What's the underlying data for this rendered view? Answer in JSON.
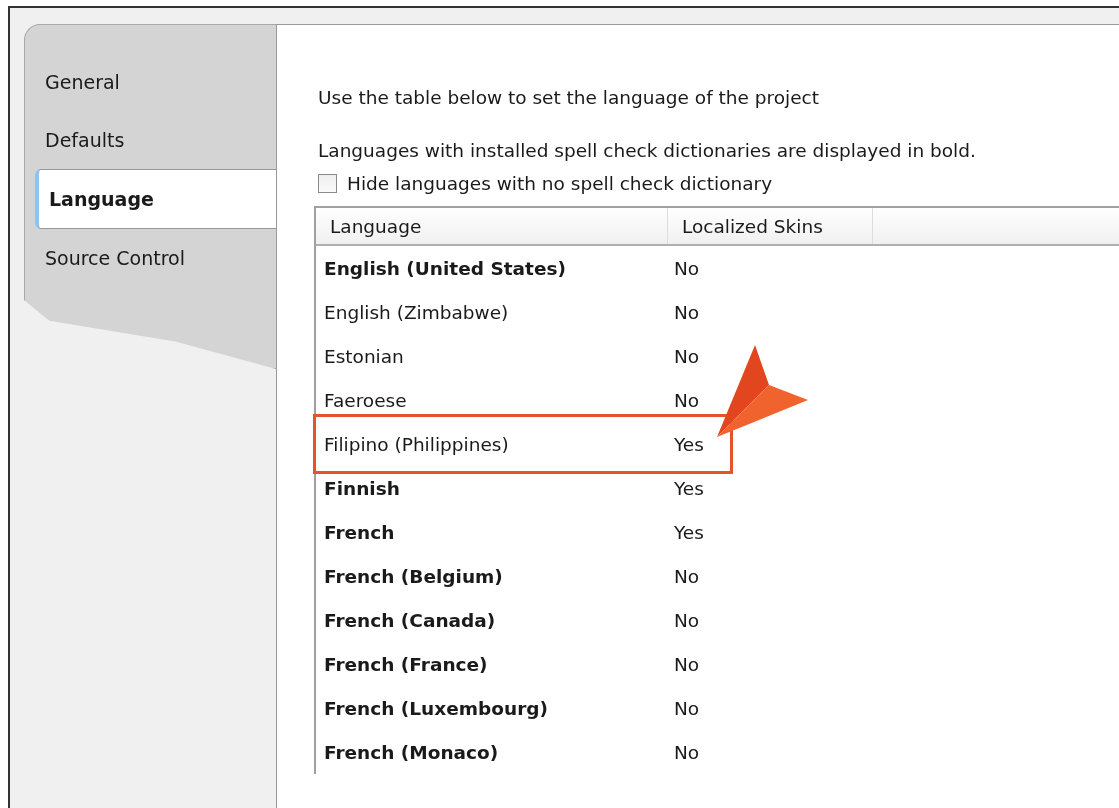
{
  "tabs": [
    {
      "label": "General",
      "selected": false
    },
    {
      "label": "Defaults",
      "selected": false
    },
    {
      "label": "Language",
      "selected": true
    },
    {
      "label": "Source Control",
      "selected": false
    }
  ],
  "intro": "Use the table below to set the language of the project",
  "note": "Languages with installed spell check dictionaries are displayed in bold.",
  "hide_checkbox": {
    "label": "Hide languages with no spell check dictionary",
    "checked": false
  },
  "table": {
    "columns": [
      "Language",
      "Localized Skins"
    ],
    "rows": [
      {
        "language": "English (United States)",
        "localized_skins": "No",
        "bold": true,
        "highlighted": false
      },
      {
        "language": "English (Zimbabwe)",
        "localized_skins": "No",
        "bold": false,
        "highlighted": false
      },
      {
        "language": "Estonian",
        "localized_skins": "No",
        "bold": false,
        "highlighted": false
      },
      {
        "language": "Faeroese",
        "localized_skins": "No",
        "bold": false,
        "highlighted": false
      },
      {
        "language": "Filipino (Philippines)",
        "localized_skins": "Yes",
        "bold": false,
        "highlighted": true
      },
      {
        "language": "Finnish",
        "localized_skins": "Yes",
        "bold": true,
        "highlighted": false
      },
      {
        "language": "French",
        "localized_skins": "Yes",
        "bold": true,
        "highlighted": false
      },
      {
        "language": "French (Belgium)",
        "localized_skins": "No",
        "bold": true,
        "highlighted": false
      },
      {
        "language": "French (Canada)",
        "localized_skins": "No",
        "bold": true,
        "highlighted": false
      },
      {
        "language": "French (France)",
        "localized_skins": "No",
        "bold": true,
        "highlighted": false
      },
      {
        "language": "French (Luxembourg)",
        "localized_skins": "No",
        "bold": true,
        "highlighted": false
      },
      {
        "language": "French (Monaco)",
        "localized_skins": "No",
        "bold": true,
        "highlighted": false
      }
    ]
  }
}
